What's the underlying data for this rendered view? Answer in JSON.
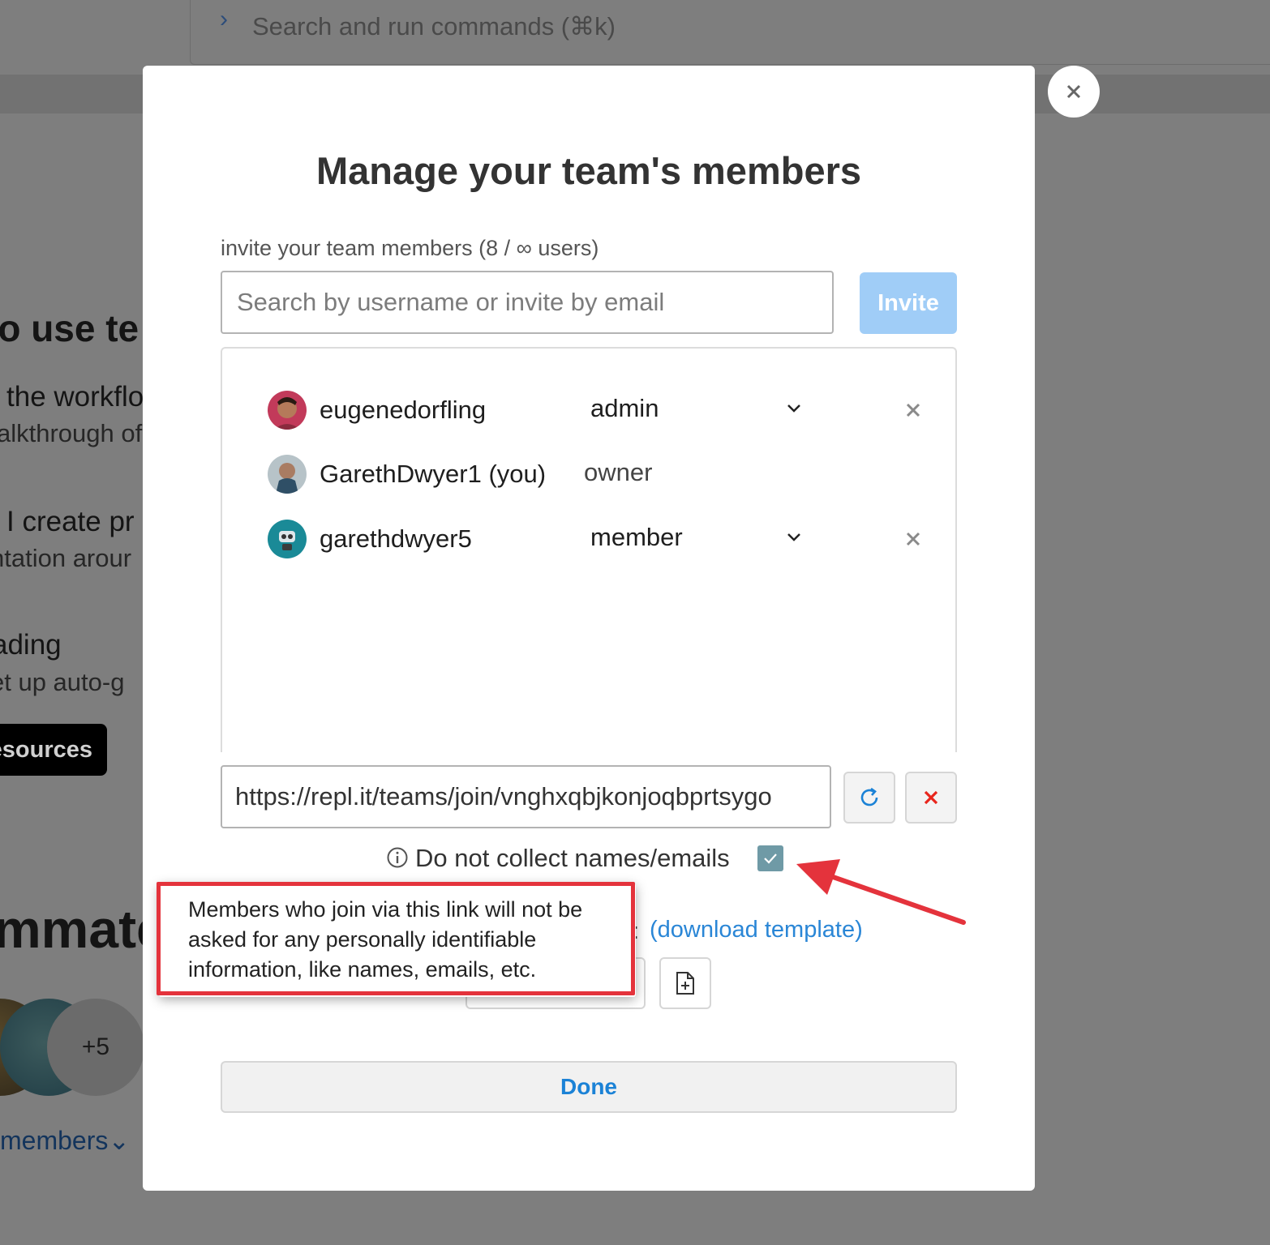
{
  "background": {
    "command_bar": {
      "chevron": "›",
      "placeholder": "Search and run commands (⌘k)"
    },
    "texts": {
      "heading1": "to use te",
      "line1": "the workflo",
      "line2": "alkthrough of",
      "line3": "I create pr",
      "line4": "ntation arour",
      "line5": "ading",
      "line6": "et up auto-g"
    },
    "resources_button": "esources",
    "heading2": "mmate",
    "avatar_more": "+5",
    "members_link": "members⌄"
  },
  "modal": {
    "title": "Manage your team's members",
    "invite_label": "invite your team members (8 / ∞ users)",
    "search_placeholder": "Search by username or invite by email",
    "invite_button": "Invite",
    "members": [
      {
        "username": "eugenedorfling",
        "role": "admin",
        "editable": true
      },
      {
        "username": "GarethDwyer1 (you)",
        "role": "owner",
        "editable": false
      },
      {
        "username": "garethdwyer5",
        "role": "member",
        "editable": true
      }
    ],
    "join_link": "https://repl.it/teams/join/vnghxqbjkonjoqbprtsygo",
    "privacy_label": "Do not collect names/emails",
    "privacy_checked": true,
    "colon": ":",
    "download_template": "(download template)",
    "done_button": "Done"
  },
  "tooltip": {
    "line1": "Members who join via this link will not be",
    "line2": "asked for any personally identifiable",
    "line3": "information, like names, emails, etc."
  },
  "colors": {
    "accent": "#1b82d6",
    "invite_disabled": "#a0cdf7",
    "annotation": "#e4333c",
    "checkbox": "#6f9aa6"
  }
}
